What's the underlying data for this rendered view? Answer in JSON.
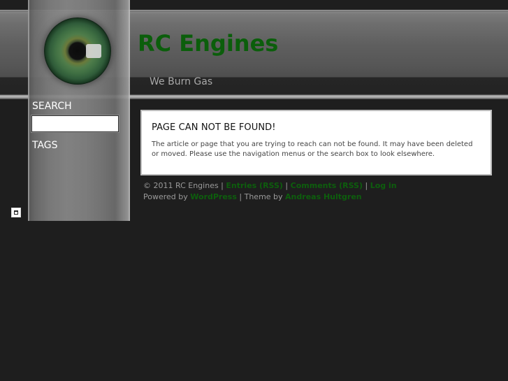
{
  "site": {
    "title": "RC Engines",
    "tagline": "We Burn Gas"
  },
  "sidebar": {
    "search_heading": "SEARCH",
    "search_value": "",
    "tags_heading": "TAGS"
  },
  "content": {
    "heading": "PAGE CAN NOT BE FOUND!",
    "body": "The article or page that you are trying to reach can not be found. It may have been deleted or moved. Please use the navigation menus or the search box to look elsewhere."
  },
  "footer": {
    "copyright": "© 2011 RC Engines |",
    "entries_rss": "Entries (RSS)",
    "sep1": "|",
    "comments_rss": "Comments (RSS)",
    "sep2": "|",
    "login": "Log in",
    "powered_by": "Powered by",
    "wordpress": "WordPress",
    "theme_by": "| Theme by",
    "theme_author": "Andreas Hultgren"
  },
  "icons": {
    "logo": "eye-logo-icon",
    "left_widget": "widget-icon"
  },
  "colors": {
    "background": "#1e1e1e",
    "title_green": "#0b5e0b",
    "link_green": "#0d5e0d",
    "tagline_gray": "#a9a9a9",
    "footer_gray": "#9a9a9a"
  }
}
